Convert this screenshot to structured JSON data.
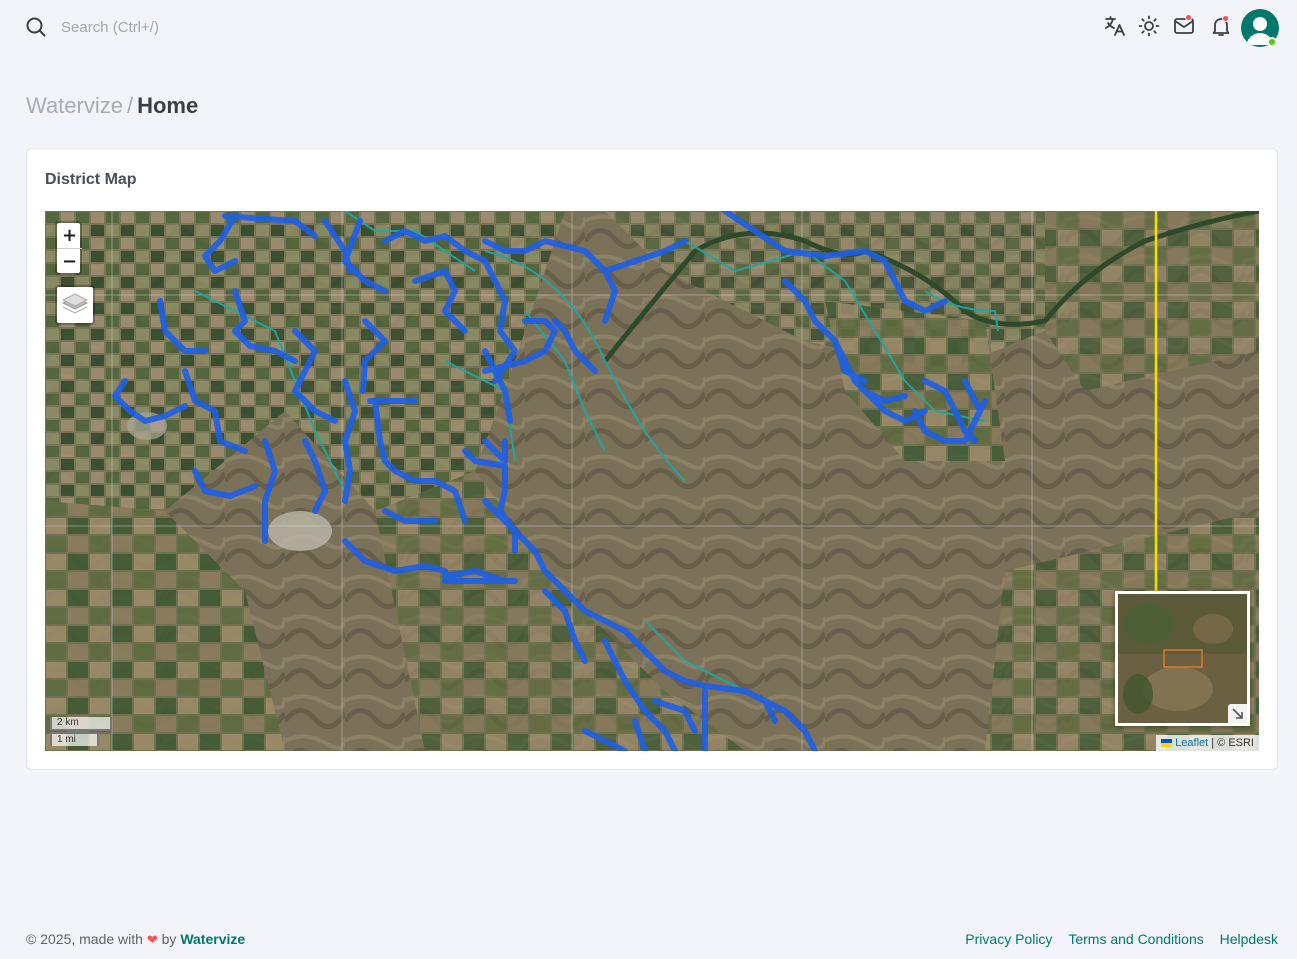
{
  "search": {
    "placeholder": "Search (Ctrl+/)"
  },
  "navbar": {
    "icons": [
      "translate-icon",
      "sun-icon",
      "mail-icon",
      "bell-icon"
    ],
    "notification_color": "#ff4c51",
    "avatar_color": "#00796b",
    "online_color": "#56ca00"
  },
  "breadcrumb": {
    "root": "Watervize",
    "separator": "/",
    "current": "Home"
  },
  "card": {
    "title": "District Map"
  },
  "map": {
    "zoom_in": "+",
    "zoom_out": "−",
    "scale_km": "2 km",
    "scale_mi": "1 mi",
    "attribution_link": "Leaflet",
    "attribution_text": " | © ESRI",
    "network_color": "#1e5fe6",
    "channel_color": "#1fa6a0",
    "boundary_color": "#f2e400",
    "minimap_extent_color": "#e07b1f"
  },
  "footer": {
    "copyright_prefix": "© 2025, made with",
    "heart": "❤",
    "by": "by",
    "brand": "Watervize",
    "links": [
      "Privacy Policy",
      "Terms and Conditions",
      "Helpdesk"
    ]
  }
}
